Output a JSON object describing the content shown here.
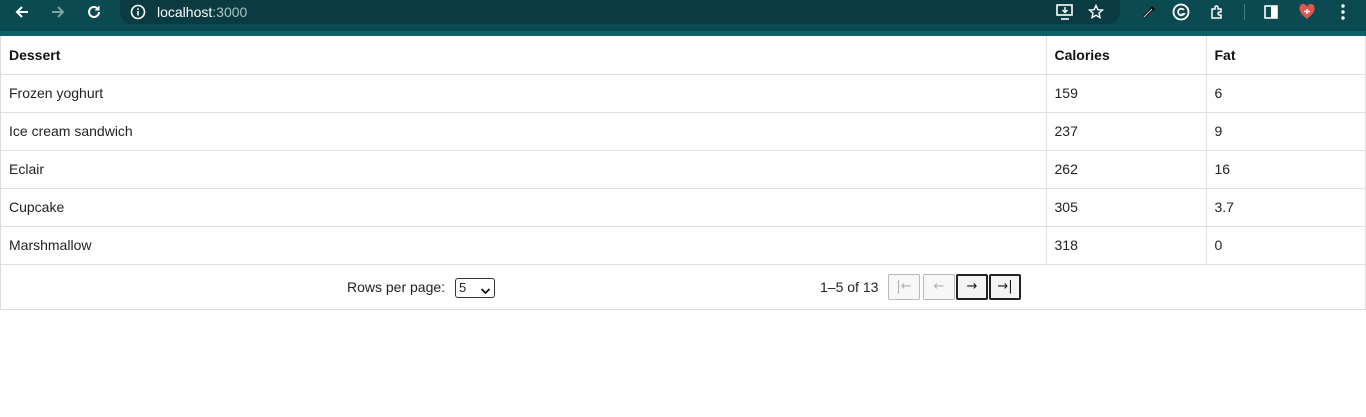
{
  "browser": {
    "url_host": "localhost",
    "url_port": ":3000"
  },
  "table": {
    "columns": [
      "Dessert",
      "Calories",
      "Fat"
    ],
    "rows": [
      [
        "Frozen yoghurt",
        "159",
        "6"
      ],
      [
        "Ice cream sandwich",
        "237",
        "9"
      ],
      [
        "Eclair",
        "262",
        "16"
      ],
      [
        "Cupcake",
        "305",
        "3.7"
      ],
      [
        "Marshmallow",
        "318",
        "0"
      ]
    ]
  },
  "pagination": {
    "rows_per_page_label": "Rows per page:",
    "rows_per_page_value": "5",
    "range_text": "1–5 of 13",
    "first_label": "|←",
    "prev_label": "←",
    "next_label": "→",
    "last_label": "→|"
  },
  "colors": {
    "chrome": "#0c4a52",
    "omnibox": "#0a3b42"
  }
}
